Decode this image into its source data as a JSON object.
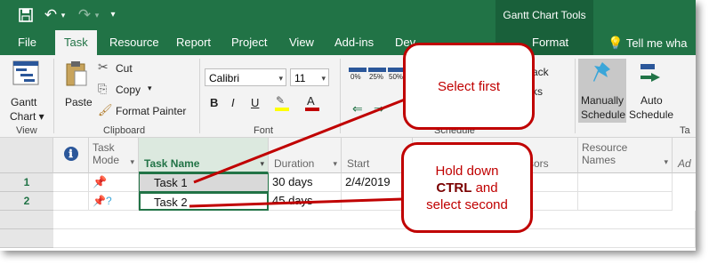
{
  "qat": {
    "undo": "↶",
    "redo": "↷",
    "more": "▾"
  },
  "title": {
    "context_tools": "Gantt Chart Tools"
  },
  "tabs": [
    {
      "label": "File"
    },
    {
      "label": "Task"
    },
    {
      "label": "Resource"
    },
    {
      "label": "Report"
    },
    {
      "label": "Project"
    },
    {
      "label": "View"
    },
    {
      "label": "Add-ins"
    },
    {
      "label": "Dev"
    },
    {
      "label": "Format"
    }
  ],
  "tell_me": "Tell me wha",
  "ribbon": {
    "view_group": {
      "gantt_label1": "Gantt",
      "gantt_label2": "Chart ▾",
      "label": "View"
    },
    "clipboard": {
      "paste": "Paste",
      "cut": "Cut",
      "copy": "Copy",
      "copy_arrow": "▾",
      "format_painter": "Format Painter",
      "label": "Clipboard"
    },
    "font": {
      "family": "Calibri",
      "size": "11",
      "bold": "B",
      "italic": "I",
      "underline": "U",
      "font_color": "A",
      "label": "Font"
    },
    "schedule": {
      "pct0": "0%",
      "pct25": "25%",
      "pct50": "50%",
      "label": "Schedule"
    },
    "mark_fragment1": "ack",
    "mark_fragment2": "ks",
    "tasks": {
      "manual1": "Manually",
      "manual2": "Schedule",
      "auto1": "Auto",
      "auto2": "Schedule",
      "label_fragment": "Ta"
    }
  },
  "grid": {
    "headers": {
      "indicator": "ℹ",
      "task_mode": "Task Mode",
      "task_mode_arrow": "▾",
      "task_name": "Task Name",
      "duration": "Duration",
      "start": "Start",
      "predecessors": "ssors",
      "resource_names": "Resource Names",
      "add": "Ad"
    },
    "rows": [
      {
        "id": "1",
        "name": "Task 1",
        "duration": "30 days",
        "start": "2/4/2019"
      },
      {
        "id": "2",
        "name": "Task 2",
        "duration": "45 days",
        "start": ""
      }
    ]
  },
  "callouts": {
    "first": "Select first",
    "second_l1": "Hold down",
    "second_l2": "CTRL",
    "second_l3": "and",
    "second_l4": "select second"
  },
  "colors": {
    "brand": "#217346",
    "callout": "#c00000"
  }
}
